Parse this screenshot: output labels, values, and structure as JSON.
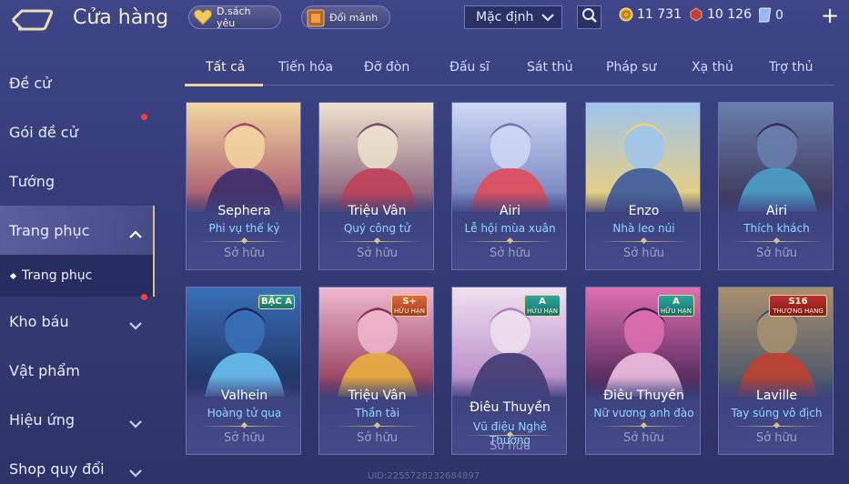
{
  "header": {
    "title": "Cửa hàng",
    "wishlist_label": "D.sách yêu",
    "exchange_label": "Đổi mảnh",
    "sort_value": "Mặc định",
    "currencies": [
      {
        "name": "gold-coin",
        "value": "11 731"
      },
      {
        "name": "red-voucher",
        "value": "10 126"
      },
      {
        "name": "blue-card",
        "value": "0"
      }
    ],
    "plus_label": "+"
  },
  "sidebar": {
    "items": [
      {
        "label": "Đề cử"
      },
      {
        "label": "Gói đề cử"
      },
      {
        "label": "Tướng"
      },
      {
        "label": "Trang phục"
      },
      {
        "label": "Kho báu"
      },
      {
        "label": "Vật phẩm"
      },
      {
        "label": "Hiệu ứng"
      },
      {
        "label": "Shop quy đổi"
      }
    ],
    "sub_label": "Trang phục"
  },
  "tabs": [
    "Tất cả",
    "Tiến hóa",
    "Đỡ đòn",
    "Đấu sĩ",
    "Sát thủ",
    "Pháp sư",
    "Xạ thủ",
    "Trợ thủ"
  ],
  "cards": [
    {
      "hero": "Sephera",
      "skin": "Phi vụ thế kỷ",
      "status": "Sở hữu",
      "colors": [
        "#f3d6a0",
        "#a04a6a",
        "#3b2c6a"
      ]
    },
    {
      "hero": "Triệu Vân",
      "skin": "Quý công tử",
      "status": "Sở hữu",
      "colors": [
        "#efe3cf",
        "#7a5070",
        "#c0405a"
      ]
    },
    {
      "hero": "Airi",
      "skin": "Lễ hội mùa xuân",
      "status": "Sở hữu",
      "colors": [
        "#cfd8f4",
        "#6a7ab8",
        "#e24a5a"
      ]
    },
    {
      "hero": "Enzo",
      "skin": "Nhà leo núi",
      "status": "Sở hữu",
      "colors": [
        "#9fc4ec",
        "#f2d070",
        "#3a5a9a"
      ]
    },
    {
      "hero": "Airi",
      "skin": "Thích khách",
      "status": "Sở hữu",
      "colors": [
        "#6a80b0",
        "#3a3050",
        "#4aa0c8"
      ]
    },
    {
      "hero": "Valhein",
      "skin": "Hoàng tử quạ",
      "status": "Sở hữu",
      "badge": "BẬC A",
      "colors": [
        "#3a70b8",
        "#1c2a58",
        "#6ac0f0"
      ]
    },
    {
      "hero": "Triệu Vân",
      "skin": "Thần tài",
      "status": "Sở hữu",
      "badge": "S+",
      "badge_sub": "HỮU HẠN",
      "colors": [
        "#f0b8d0",
        "#8a3050",
        "#e8b040"
      ]
    },
    {
      "hero": "Điêu Thuyền",
      "skin": "Vũ điệu Nghê Thường",
      "status": "Sở hữu",
      "badge": "A",
      "badge_sub": "HỮU HẠN",
      "colors": [
        "#f0e0f0",
        "#b080c0",
        "#403870"
      ]
    },
    {
      "hero": "Điêu Thuyền",
      "skin": "Nữ vương anh đào",
      "status": "Sở hữu",
      "badge": "A",
      "badge_sub": "HỮU HẠN",
      "colors": [
        "#e070b0",
        "#402050",
        "#f0c0e0"
      ]
    },
    {
      "hero": "Laville",
      "skin": "Tay súng vô địch",
      "status": "Sở hữu",
      "badge": "S16",
      "badge_sub": "THƯỢNG HẠNG",
      "colors": [
        "#a89070",
        "#40506a",
        "#c04030"
      ]
    }
  ],
  "uid": "UID:2255728232684897"
}
